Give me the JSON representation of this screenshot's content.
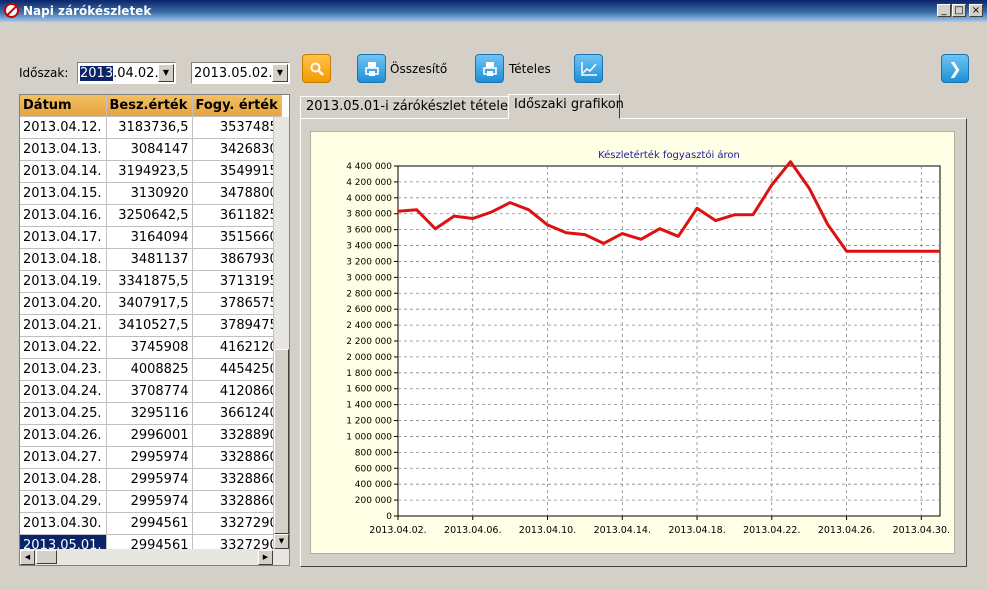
{
  "window": {
    "title": "Napi zárókészletek",
    "minimize": "_",
    "maximize": "□",
    "close": "×"
  },
  "toolbar": {
    "period_label": "Időszak:",
    "date_from": {
      "selected": "2013",
      "rest": ".04.02."
    },
    "date_to": "2013.05.02.",
    "summary_label": "Összesítő",
    "detail_label": "Tételes",
    "search_icon": "magnifier-icon",
    "chart_icon": "line-chart-icon",
    "next_icon": "chevron-right-icon"
  },
  "grid": {
    "columns": [
      "Dátum",
      "Besz.érték",
      "Fogy. érték"
    ],
    "rows": [
      [
        "2013.04.12.",
        "3183736,5",
        "3537485"
      ],
      [
        "2013.04.13.",
        "3084147",
        "3426830"
      ],
      [
        "2013.04.14.",
        "3194923,5",
        "3549915"
      ],
      [
        "2013.04.15.",
        "3130920",
        "3478800"
      ],
      [
        "2013.04.16.",
        "3250642,5",
        "3611825"
      ],
      [
        "2013.04.17.",
        "3164094",
        "3515660"
      ],
      [
        "2013.04.18.",
        "3481137",
        "3867930"
      ],
      [
        "2013.04.19.",
        "3341875,5",
        "3713195"
      ],
      [
        "2013.04.20.",
        "3407917,5",
        "3786575"
      ],
      [
        "2013.04.21.",
        "3410527,5",
        "3789475"
      ],
      [
        "2013.04.22.",
        "3745908",
        "4162120"
      ],
      [
        "2013.04.23.",
        "4008825",
        "4454250"
      ],
      [
        "2013.04.24.",
        "3708774",
        "4120860"
      ],
      [
        "2013.04.25.",
        "3295116",
        "3661240"
      ],
      [
        "2013.04.26.",
        "2996001",
        "3328890"
      ],
      [
        "2013.04.27.",
        "2995974",
        "3328860"
      ],
      [
        "2013.04.28.",
        "2995974",
        "3328860"
      ],
      [
        "2013.04.29.",
        "2995974",
        "3328860"
      ],
      [
        "2013.04.30.",
        "2994561",
        "3327290"
      ],
      [
        "2013.05.01.",
        "2994561",
        "3327290"
      ]
    ],
    "selected_row": 19
  },
  "tabs": [
    "2013.05.01-i zárókészlet tételesen",
    "Időszaki grafikon"
  ],
  "active_tab": 1,
  "chart_data": {
    "type": "line",
    "title": "Készletérték fogyasztói áron",
    "x": [
      "2013.04.02.",
      "2013.04.03.",
      "2013.04.04.",
      "2013.04.05.",
      "2013.04.06.",
      "2013.04.07.",
      "2013.04.08.",
      "2013.04.09.",
      "2013.04.10.",
      "2013.04.11.",
      "2013.04.12.",
      "2013.04.13.",
      "2013.04.14.",
      "2013.04.15.",
      "2013.04.16.",
      "2013.04.17.",
      "2013.04.18.",
      "2013.04.19.",
      "2013.04.20.",
      "2013.04.21.",
      "2013.04.22.",
      "2013.04.23.",
      "2013.04.24.",
      "2013.04.25.",
      "2013.04.26.",
      "2013.04.27.",
      "2013.04.28.",
      "2013.04.29.",
      "2013.04.30.",
      "2013.05.01."
    ],
    "xtick_labels": [
      "2013.04.02.",
      "2013.04.06.",
      "2013.04.10.",
      "2013.04.14.",
      "2013.04.18.",
      "2013.04.22.",
      "2013.04.26.",
      "2013.04.30."
    ],
    "series": [
      {
        "values": [
          3830000,
          3850000,
          3610000,
          3770000,
          3740000,
          3820000,
          3940000,
          3850000,
          3660000,
          3560000,
          3537485,
          3426830,
          3549915,
          3478800,
          3611825,
          3515660,
          3867930,
          3713195,
          3786575,
          3789475,
          4162120,
          4454250,
          4120860,
          3661240,
          3328890,
          3328860,
          3328860,
          3328860,
          3327290,
          3327290
        ],
        "color": "#dd1111"
      }
    ],
    "ylim": [
      0,
      4400000
    ],
    "yticks": [
      "0",
      "200 000",
      "400 000",
      "600 000",
      "800 000",
      "1 000 000",
      "1 200 000",
      "1 400 000",
      "1 600 000",
      "1 800 000",
      "2 000 000",
      "2 200 000",
      "2 400 000",
      "2 600 000",
      "2 800 000",
      "3 000 000",
      "3 200 000",
      "3 400 000",
      "3 600 000",
      "3 800 000",
      "4 000 000",
      "4 200 000",
      "4 400 000"
    ],
    "grid": true
  }
}
